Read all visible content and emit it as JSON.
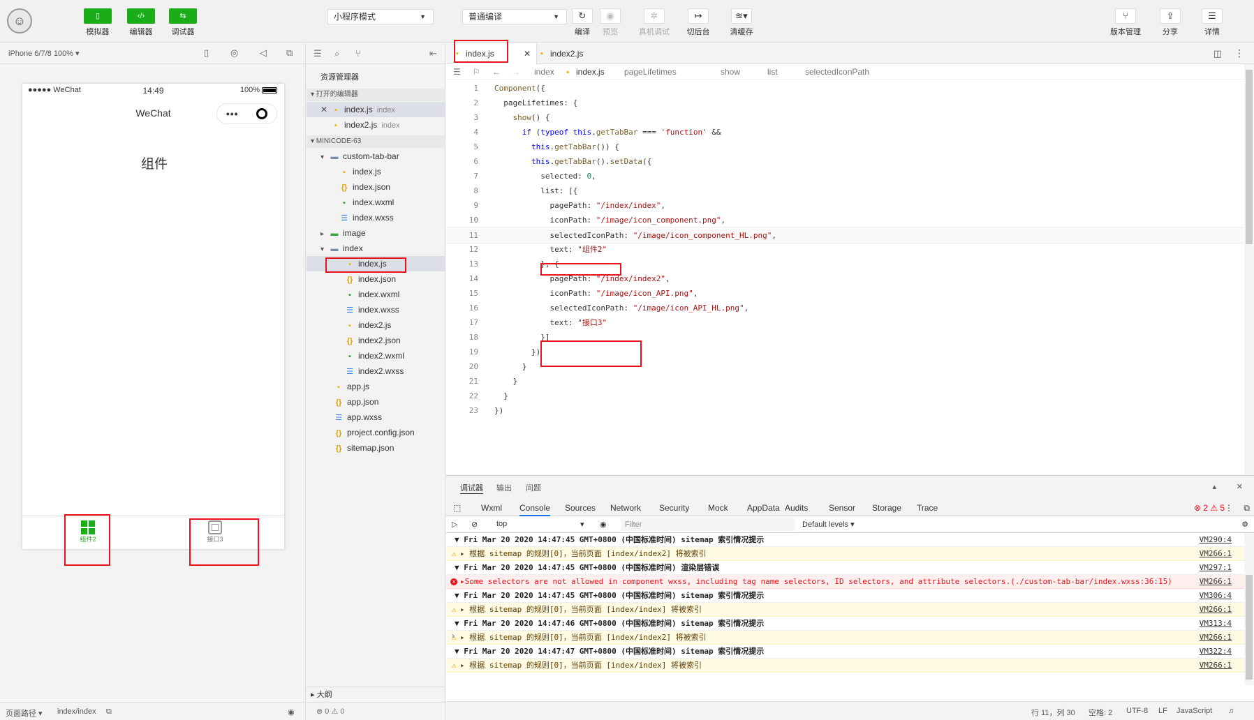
{
  "toolbar": {
    "avatar_glyph": "☺",
    "simulator_label": "模拟器",
    "editor_label": "编辑器",
    "debugger_label": "调试器",
    "mode_select": "小程序模式",
    "compile_select": "普通编译",
    "compile_label": "编译",
    "preview_label": "预览",
    "remote_debug_label": "真机调试",
    "background_label": "切后台",
    "clear_cache_label": "清缓存",
    "version_label": "版本管理",
    "share_label": "分享",
    "details_label": "详情"
  },
  "simulator": {
    "device": "iPhone 6/7/8 100% ▾",
    "status_signal": "●●●●● WeChat",
    "status_time": "14:49",
    "status_battery": "100%",
    "nav_title": "WeChat",
    "page_text": "组件",
    "tab1_label": "组件2",
    "tab2_label": "接口3",
    "footer_path_label": "页面路径 ▾",
    "footer_path": "index/index"
  },
  "explorer": {
    "title": "资源管理器",
    "open_editors": "▾ 打开的编辑器",
    "open_items": [
      {
        "name": "index.js",
        "suffix": "index"
      },
      {
        "name": "index2.js",
        "suffix": "index"
      }
    ],
    "project": "▾ MINICODE-63",
    "tree": [
      {
        "name": "custom-tab-bar",
        "type": "folder",
        "arrow": "▾"
      },
      {
        "name": "index.js",
        "type": "js"
      },
      {
        "name": "index.json",
        "type": "json"
      },
      {
        "name": "index.wxml",
        "type": "wxml"
      },
      {
        "name": "index.wxss",
        "type": "wxss"
      },
      {
        "name": "image",
        "type": "img",
        "arrow": "▸"
      },
      {
        "name": "index",
        "type": "folder",
        "arrow": "▾"
      },
      {
        "name": "index.js",
        "type": "js"
      },
      {
        "name": "index.json",
        "type": "json"
      },
      {
        "name": "index.wxml",
        "type": "wxml"
      },
      {
        "name": "index.wxss",
        "type": "wxss"
      },
      {
        "name": "index2.js",
        "type": "js"
      },
      {
        "name": "index2.json",
        "type": "json"
      },
      {
        "name": "index2.wxml",
        "type": "wxml"
      },
      {
        "name": "index2.wxss",
        "type": "wxss"
      },
      {
        "name": "app.js",
        "type": "js"
      },
      {
        "name": "app.json",
        "type": "json"
      },
      {
        "name": "app.wxss",
        "type": "wxss"
      },
      {
        "name": "project.config.json",
        "type": "json"
      },
      {
        "name": "sitemap.json",
        "type": "json"
      }
    ],
    "outline": "▸ 大纲",
    "problems": "⊗ 0 ⚠ 0"
  },
  "editor": {
    "tabs": [
      {
        "name": "index.js",
        "close": "✕"
      },
      {
        "name": "index2.js"
      }
    ],
    "breadcrumb": [
      "index",
      "index.js",
      "pageLifetimes",
      "show",
      "list",
      "selectedIconPath"
    ],
    "lines": [
      "Component({",
      "  pageLifetimes: {",
      "    show() {",
      "      if (typeof this.getTabBar === 'function' &&",
      "        this.getTabBar()) {",
      "        this.getTabBar().setData({",
      "          selected: 0,",
      "          list: [{",
      "            pagePath: \"/index/index\",",
      "            iconPath: \"/image/icon_component.png\",",
      "            selectedIconPath: \"/image/icon_component_HL.png\",",
      "            text: \"组件2\"",
      "          }, {",
      "            pagePath: \"/index/index2\",",
      "            iconPath: \"/image/icon_API.png\",",
      "            selectedIconPath: \"/image/icon_API_HL.png\",",
      "            text: \"接口3\"",
      "          }]",
      "        })",
      "      }",
      "    }",
      "  }",
      "})"
    ]
  },
  "debugger": {
    "top_tabs": [
      "调试器",
      "输出",
      "问题"
    ],
    "tabs": [
      "Wxml",
      "Console",
      "Sources",
      "Network",
      "Security",
      "Mock",
      "AppData",
      "Audits",
      "Sensor",
      "Storage",
      "Trace"
    ],
    "counts": "⊗ 2 ⚠ 5",
    "context": "top",
    "filter_placeholder": "Filter",
    "levels": "Default levels ▾",
    "console": [
      {
        "kind": "group",
        "text": "▼ Fri Mar 20 2020 14:47:45 GMT+0800 (中国标准时间) sitemap 索引情况提示",
        "ref": "VM290:4"
      },
      {
        "kind": "warn",
        "text": "▸ 根据 sitemap 的规则[0]，当前页面 [index/index2] 将被索引",
        "ref": "VM266:1"
      },
      {
        "kind": "group",
        "text": "▼ Fri Mar 20 2020 14:47:45 GMT+0800 (中国标准时间) 渲染层错误",
        "ref": "VM297:1"
      },
      {
        "kind": "err",
        "text": "▸Some selectors are not allowed in component wxss, including tag name selectors, ID selectors, and attribute selectors.(./custom-tab-bar/index.wxss:36:15)",
        "ref": "VM266:1"
      },
      {
        "kind": "group",
        "text": "▼ Fri Mar 20 2020 14:47:45 GMT+0800 (中国标准时间) sitemap 索引情况提示",
        "ref": "VM306:4"
      },
      {
        "kind": "warn",
        "text": "▸ 根据 sitemap 的规则[0]，当前页面 [index/index] 将被索引",
        "ref": "VM266:1"
      },
      {
        "kind": "group",
        "text": "▼ Fri Mar 20 2020 14:47:46 GMT+0800 (中国标准时间) sitemap 索引情况提示",
        "ref": "VM313:4"
      },
      {
        "kind": "warn",
        "text": "▸ 根据 sitemap 的规则[0]，当前页面 [index/index2] 将被索引",
        "ref": "VM266:1"
      },
      {
        "kind": "group",
        "text": "▼ Fri Mar 20 2020 14:47:47 GMT+0800 (中国标准时间) sitemap 索引情况提示",
        "ref": "VM322:4"
      },
      {
        "kind": "warn",
        "text": "▸ 根据 sitemap 的规则[0]，当前页面 [index/index] 将被索引",
        "ref": "VM266:1"
      }
    ],
    "prompt": "›"
  },
  "statusbar": {
    "position": "行 11，列 30",
    "indent": "空格: 2",
    "encoding": "UTF-8",
    "eol": "LF",
    "language": "JavaScript"
  }
}
